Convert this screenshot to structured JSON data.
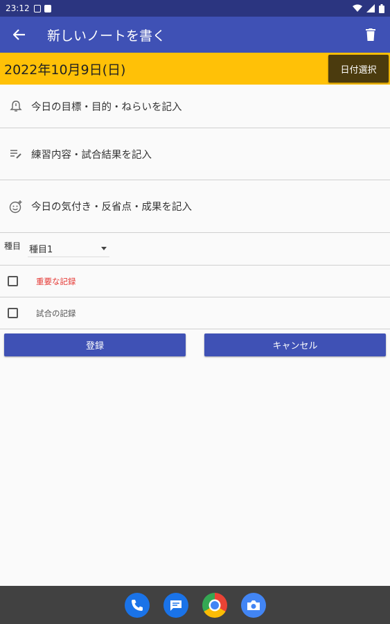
{
  "status_bar": {
    "time": "23:12"
  },
  "app_bar": {
    "title": "新しいノートを書く"
  },
  "date_bar": {
    "date": "2022年10月9日(日)",
    "select_button": "日付選択"
  },
  "fields": [
    {
      "label": "今日の目標・目的・ねらいを記入",
      "icon": "bell-icon"
    },
    {
      "label": "練習内容・試合結果を記入",
      "icon": "notes-edit-icon"
    },
    {
      "label": "今日の気付き・反省点・成果を記入",
      "icon": "smiley-add-icon"
    }
  ],
  "category": {
    "label": "種目",
    "selected": "種目1"
  },
  "checks": [
    {
      "label": "重要な記録",
      "color": "#e53935"
    },
    {
      "label": "試合の記録",
      "color": "#555555"
    }
  ],
  "buttons": {
    "register": "登録",
    "cancel": "キャンセル"
  },
  "colors": {
    "primary": "#3f51b5",
    "accent": "#ffc107",
    "status_bar": "#2b3580"
  },
  "dock_icons": [
    "phone-icon",
    "messages-icon",
    "chrome-icon",
    "camera-icon"
  ]
}
